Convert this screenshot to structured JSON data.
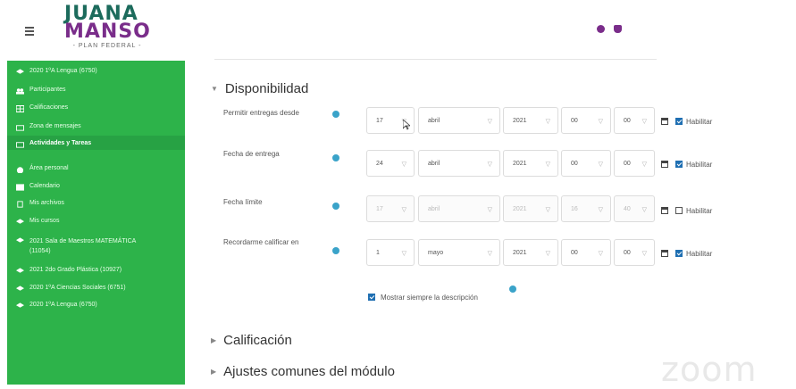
{
  "brand": {
    "line1": "JUANA",
    "line2": "MANSO",
    "line3": "- PLAN FEDERAL -"
  },
  "sidebar": {
    "items": [
      {
        "label": "2020 1ºA Lengua (6750)",
        "icon": "graduation-cap-icon"
      },
      {
        "label": "Participantes",
        "icon": "users-icon"
      },
      {
        "label": "Calificaciones",
        "icon": "grid-icon"
      },
      {
        "label": "Zona de mensajes",
        "icon": "folder-icon"
      },
      {
        "label": "Actividades y Tareas",
        "icon": "folder-icon"
      },
      {
        "label": "Área personal",
        "icon": "dashboard-icon"
      },
      {
        "label": "Calendario",
        "icon": "calendar-icon"
      },
      {
        "label": "Mis archivos",
        "icon": "file-icon"
      },
      {
        "label": "Mis cursos",
        "icon": "graduation-cap-icon"
      },
      {
        "label": "2021 Sala de Maestros MATEMÁTICA (11054)",
        "icon": "graduation-cap-icon"
      },
      {
        "label": "2021 2do Grado Plástica (10927)",
        "icon": "graduation-cap-icon"
      },
      {
        "label": "2020 1ºA Ciencias Sociales (6751)",
        "icon": "graduation-cap-icon"
      },
      {
        "label": "2020 1ºA Lengua (6750)",
        "icon": "graduation-cap-icon"
      }
    ]
  },
  "sections": {
    "availability": "Disponibilidad",
    "grading": "Calificación",
    "common": "Ajustes comunes del módulo"
  },
  "rows": [
    {
      "label": "Permitir entregas desde",
      "day": "17",
      "month": "abril",
      "year": "2021",
      "hour": "00",
      "minute": "00",
      "enable_label": "Habilitar"
    },
    {
      "label": "Fecha de entrega",
      "day": "24",
      "month": "abril",
      "year": "2021",
      "hour": "00",
      "minute": "00",
      "enable_label": "Habilitar"
    },
    {
      "label": "Fecha límite",
      "day": "17",
      "month": "abril",
      "year": "2021",
      "hour": "16",
      "minute": "40",
      "enable_label": "Habilitar"
    },
    {
      "label": "Recordarme calificar en",
      "day": "1",
      "month": "mayo",
      "year": "2021",
      "hour": "00",
      "minute": "00",
      "enable_label": "Habilitar"
    }
  ],
  "show_description": "Mostrar siempre la descripción",
  "watermark": "zoom",
  "colors": {
    "sidebar": "#2db34a",
    "accent": "#1f6fb2",
    "info": "#3aa3c9"
  }
}
